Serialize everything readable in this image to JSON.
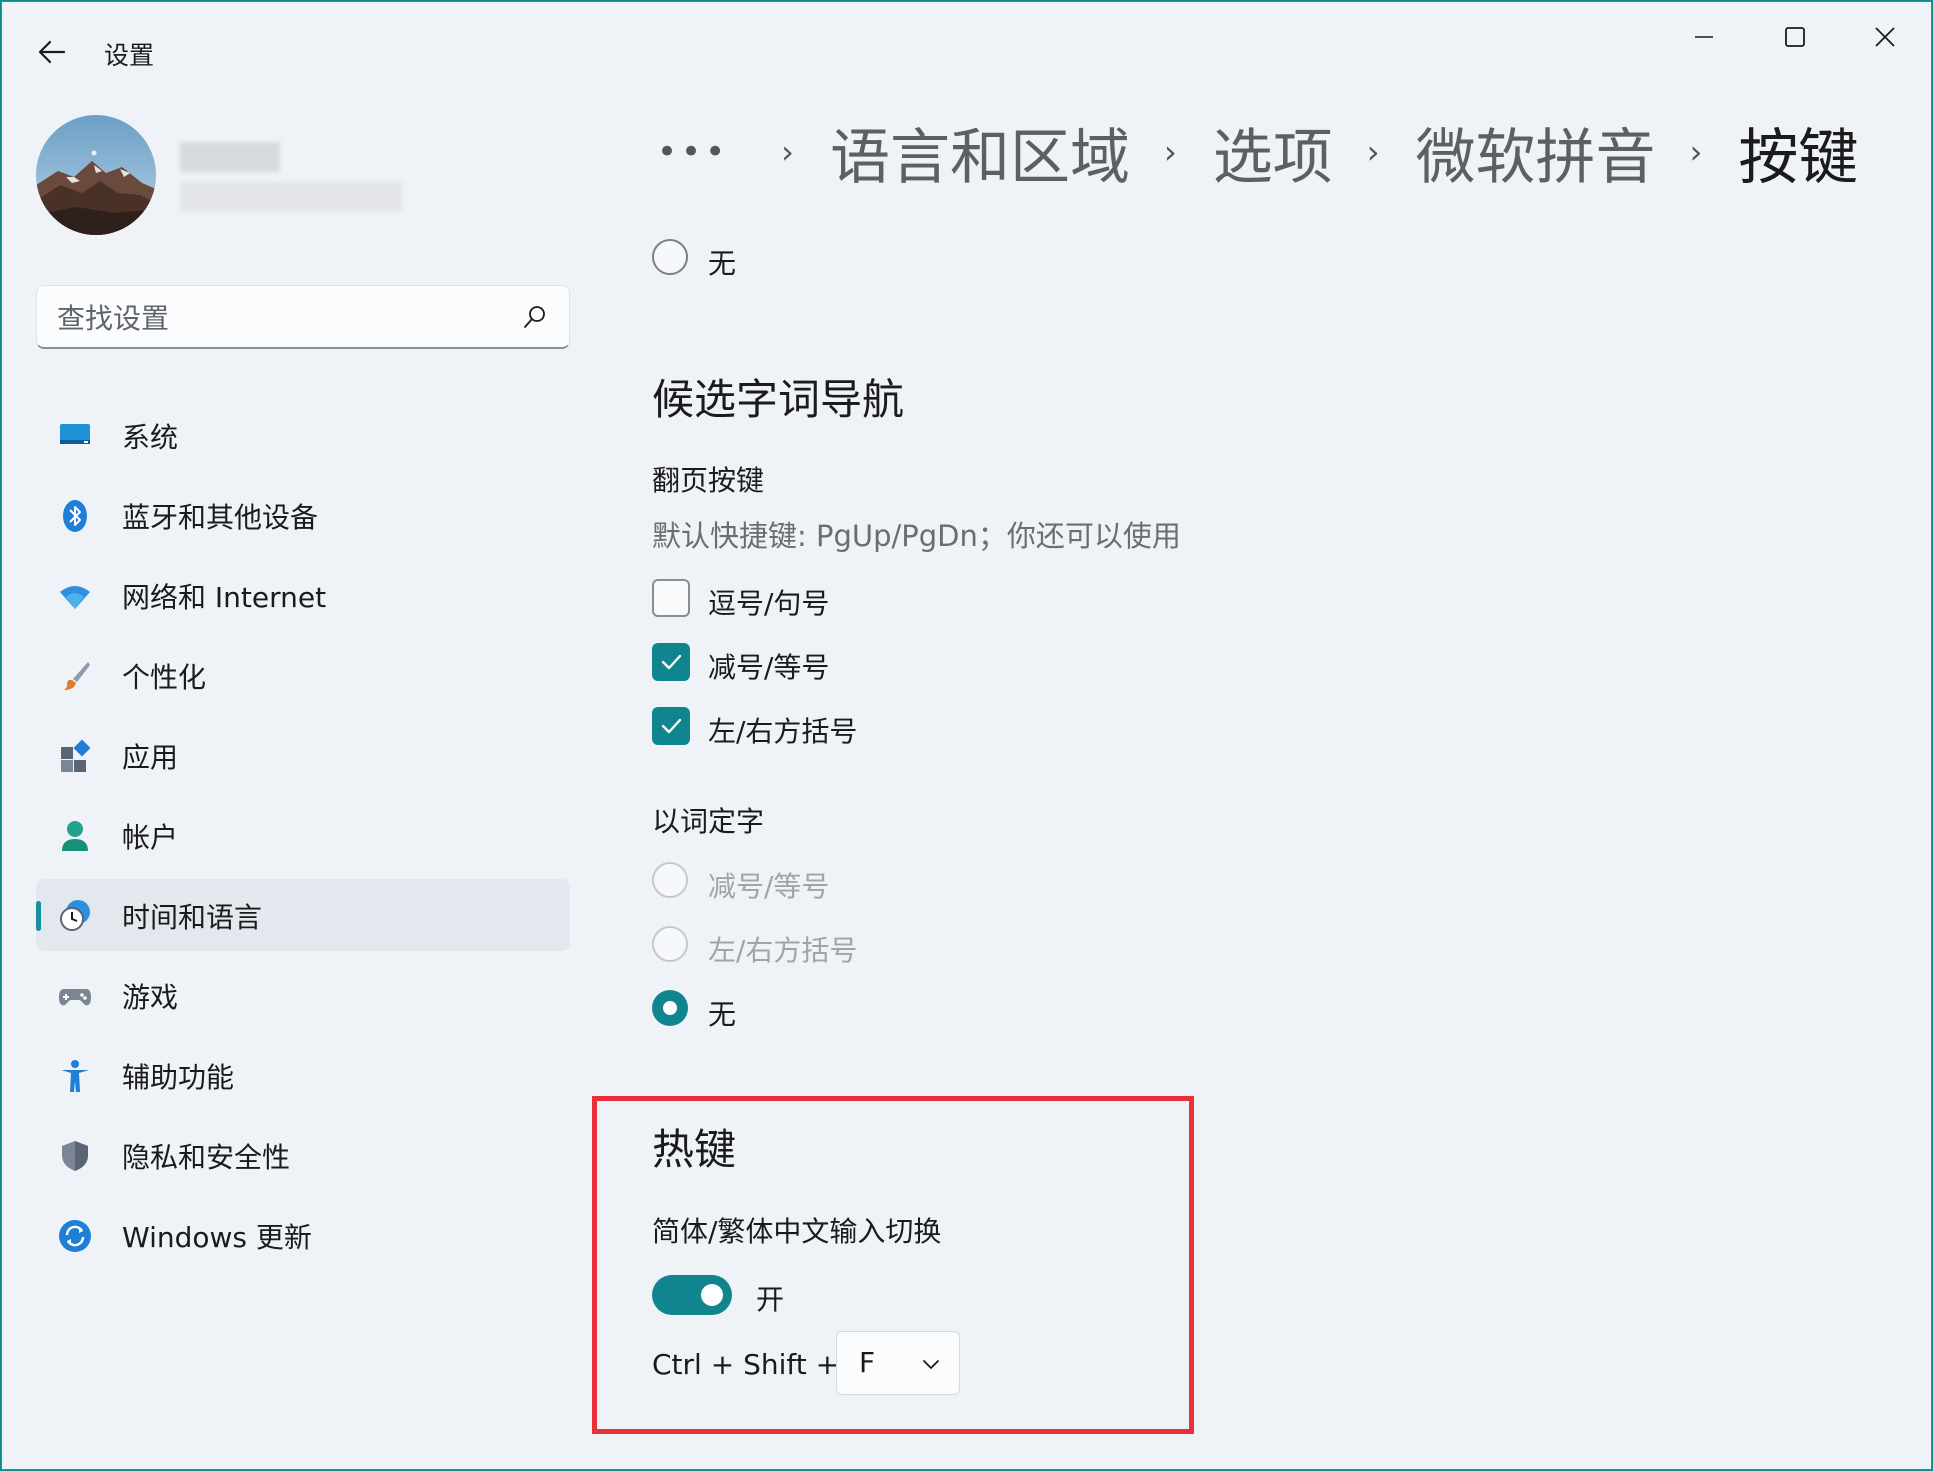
{
  "window": {
    "app_title": "设置"
  },
  "sidebar": {
    "search_placeholder": "查找设置",
    "items": [
      {
        "label": "系统",
        "icon": "display-icon"
      },
      {
        "label": "蓝牙和其他设备",
        "icon": "bluetooth-icon"
      },
      {
        "label": "网络和 Internet",
        "icon": "wifi-icon"
      },
      {
        "label": "个性化",
        "icon": "brush-icon"
      },
      {
        "label": "应用",
        "icon": "apps-icon"
      },
      {
        "label": "帐户",
        "icon": "person-icon"
      },
      {
        "label": "时间和语言",
        "icon": "clock-globe-icon",
        "active": true
      },
      {
        "label": "游戏",
        "icon": "gamepad-icon"
      },
      {
        "label": "辅助功能",
        "icon": "accessibility-icon"
      },
      {
        "label": "隐私和安全性",
        "icon": "shield-icon"
      },
      {
        "label": "Windows 更新",
        "icon": "update-icon"
      }
    ]
  },
  "breadcrumb": {
    "more": "•••",
    "items": [
      "语言和区域",
      "选项",
      "微软拼音"
    ],
    "current": "按键",
    "separator": "›"
  },
  "content": {
    "top_option": {
      "label": "无",
      "selected": false
    },
    "candidate_nav": {
      "title": "候选字词导航",
      "page_keys_title": "翻页按键",
      "page_keys_desc": "默认快捷键: PgUp/PgDn；你还可以使用",
      "checkboxes": [
        {
          "label": "逗号/句号",
          "checked": false
        },
        {
          "label": "减号/等号",
          "checked": true
        },
        {
          "label": "左/右方括号",
          "checked": true
        }
      ],
      "word_select_title": "以词定字",
      "radios": [
        {
          "label": "减号/等号",
          "selected": false,
          "disabled": true
        },
        {
          "label": "左/右方括号",
          "selected": false,
          "disabled": true
        },
        {
          "label": "无",
          "selected": true,
          "disabled": false
        }
      ]
    },
    "hotkeys": {
      "title": "热键",
      "switch_label": "简体/繁体中文输入切换",
      "toggle_state": "开",
      "toggle_on": true,
      "shortcut_prefix": "Ctrl + Shift +",
      "key_value": "F"
    }
  },
  "colors": {
    "accent": "#11858e",
    "highlight_box": "#e8303a",
    "window_bg": "#eff3f8"
  }
}
